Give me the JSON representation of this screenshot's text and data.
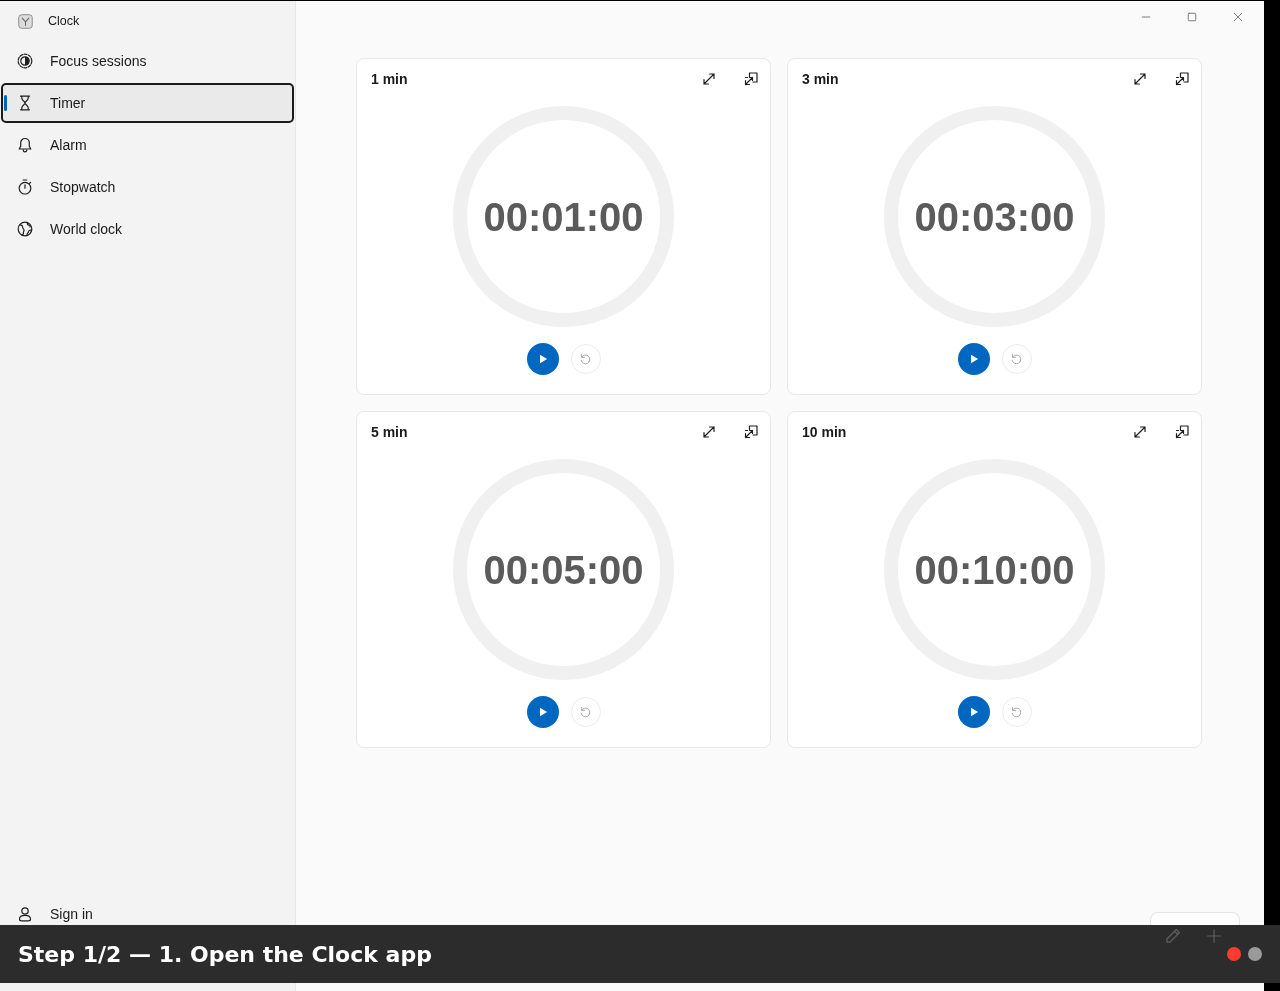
{
  "window": {
    "title": "Clock"
  },
  "sidebar": {
    "items": [
      {
        "label": "Focus sessions",
        "selected": false
      },
      {
        "label": "Timer",
        "selected": true
      },
      {
        "label": "Alarm",
        "selected": false
      },
      {
        "label": "Stopwatch",
        "selected": false
      },
      {
        "label": "World clock",
        "selected": false
      }
    ],
    "account": {
      "label": "Sign in"
    }
  },
  "timers": [
    {
      "title": "1 min",
      "time": "00:01:00"
    },
    {
      "title": "3 min",
      "time": "00:03:00"
    },
    {
      "title": "5 min",
      "time": "00:05:00"
    },
    {
      "title": "10 min",
      "time": "00:10:00"
    }
  ],
  "step_banner": {
    "text": "Step 1/2 — 1. Open the Clock app",
    "dots": [
      {
        "selected": true
      },
      {
        "selected": false
      }
    ]
  }
}
